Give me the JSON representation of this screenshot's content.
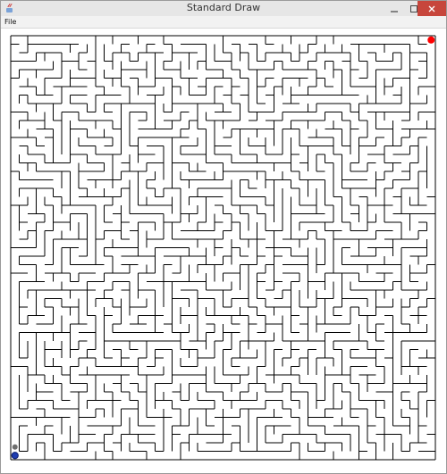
{
  "window": {
    "title": "Standard Draw"
  },
  "titlebar": {
    "app_icon": "java-coffee-icon",
    "minimize": "minimize-icon",
    "maximize": "maximize-icon",
    "close": "close-icon"
  },
  "menubar": {
    "items": [
      {
        "label": "File"
      }
    ]
  },
  "maze": {
    "grid": 50,
    "wall_color": "#000000",
    "background_color": "#ffffff",
    "goal_dot": {
      "color": "#ff0000",
      "position": "top-right cell"
    },
    "start_markers": [
      {
        "color": "#6f6f6f",
        "position": "second row from bottom, left column"
      },
      {
        "color": "#1f3db0",
        "position": "bottom-left cell"
      }
    ]
  }
}
